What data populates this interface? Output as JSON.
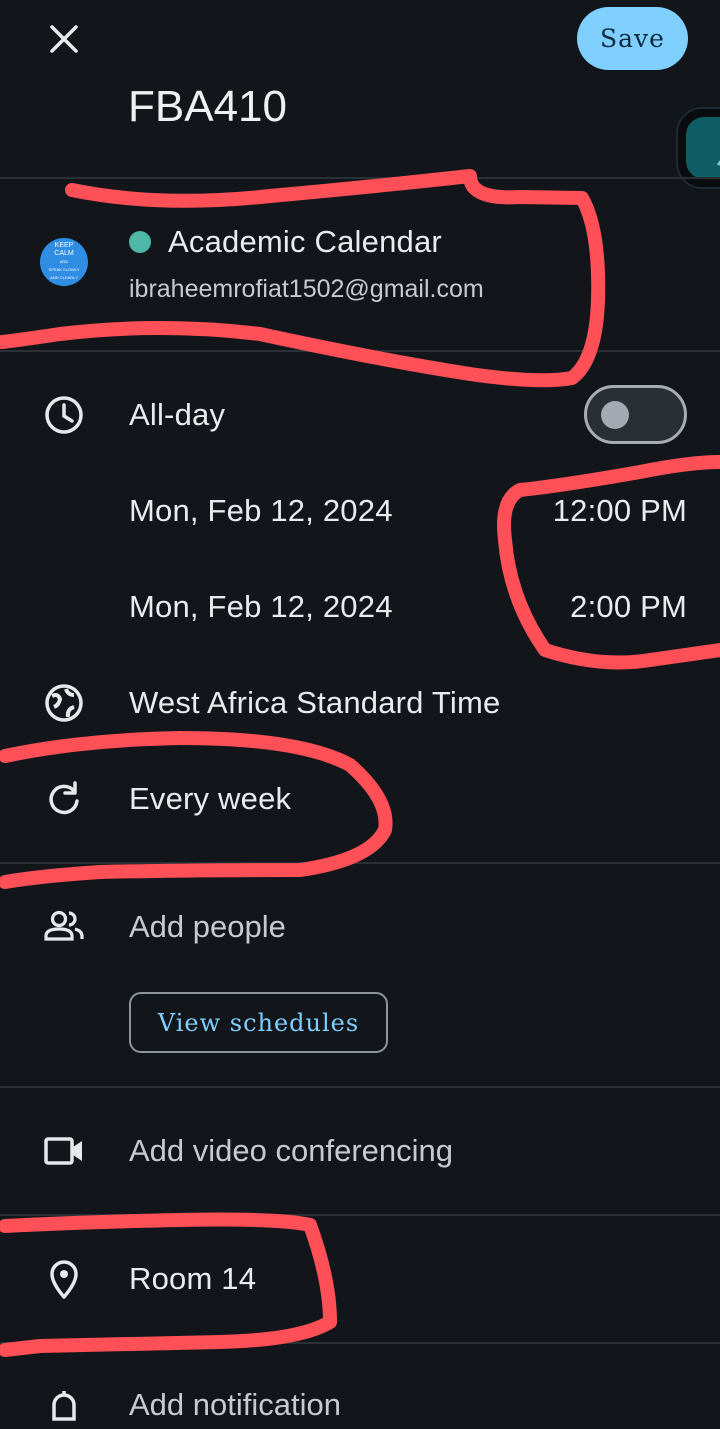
{
  "header": {
    "title": "FBA410",
    "save_label": "Save"
  },
  "account": {
    "calendar_name": "Academic Calendar",
    "email": "ibraheemrofiat1502@gmail.com",
    "avatar_lines": [
      "KEEP",
      "CALM",
      "AND",
      "SPEAK SLOWLY",
      "AND CLEARLY"
    ],
    "calendar_color": "#4fb7a8"
  },
  "time": {
    "all_day_label": "All-day",
    "all_day_on": false,
    "start_date": "Mon, Feb 12, 2024",
    "start_time": "12:00 PM",
    "end_date": "Mon, Feb 12, 2024",
    "end_time": "2:00 PM",
    "timezone": "West Africa Standard Time",
    "repeat": "Every week"
  },
  "people": {
    "add_label": "Add people",
    "view_schedules_label": "View schedules"
  },
  "video": {
    "label": "Add video conferencing"
  },
  "location": {
    "value": "Room 14"
  },
  "notification": {
    "label": "Add notification"
  },
  "colors": {
    "background": "#12161b",
    "accent": "#7fcfff",
    "annotation": "#ff4f57"
  }
}
